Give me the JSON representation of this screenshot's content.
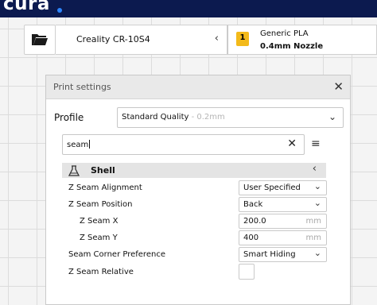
{
  "app": {
    "logo_text": "cura"
  },
  "machine": {
    "printer_name": "Creality CR-10S4",
    "printer_chevron": "‹",
    "material_badge": "1",
    "material_name": "Generic PLA",
    "nozzle": "0.4mm Nozzle"
  },
  "panel": {
    "title": "Print settings",
    "close": "✕",
    "profile_label": "Profile",
    "profile_value": "Standard Quality",
    "profile_sub": " - 0.2mm",
    "profile_chevron": "⌄",
    "search_value": "seam",
    "search_clear": "✕",
    "menu_icon": "≡",
    "category": {
      "label": "Shell",
      "chevron": "‹"
    },
    "settings": [
      {
        "label": "Z Seam Alignment",
        "type": "select",
        "value": "User Specified"
      },
      {
        "label": "Z Seam Position",
        "type": "select",
        "value": "Back"
      },
      {
        "label": "Z Seam X",
        "type": "number",
        "value": "200.0",
        "unit": "mm"
      },
      {
        "label": "Z Seam Y",
        "type": "number",
        "value": "400",
        "unit": "mm"
      },
      {
        "label": "Seam Corner Preference",
        "type": "select",
        "value": "Smart Hiding"
      },
      {
        "label": "Z Seam Relative",
        "type": "checkbox",
        "value": "unchecked"
      }
    ]
  },
  "colors": {
    "topbar": "#0c1a4f",
    "accent": "#2d86ff",
    "badge": "#f3ba1a"
  }
}
